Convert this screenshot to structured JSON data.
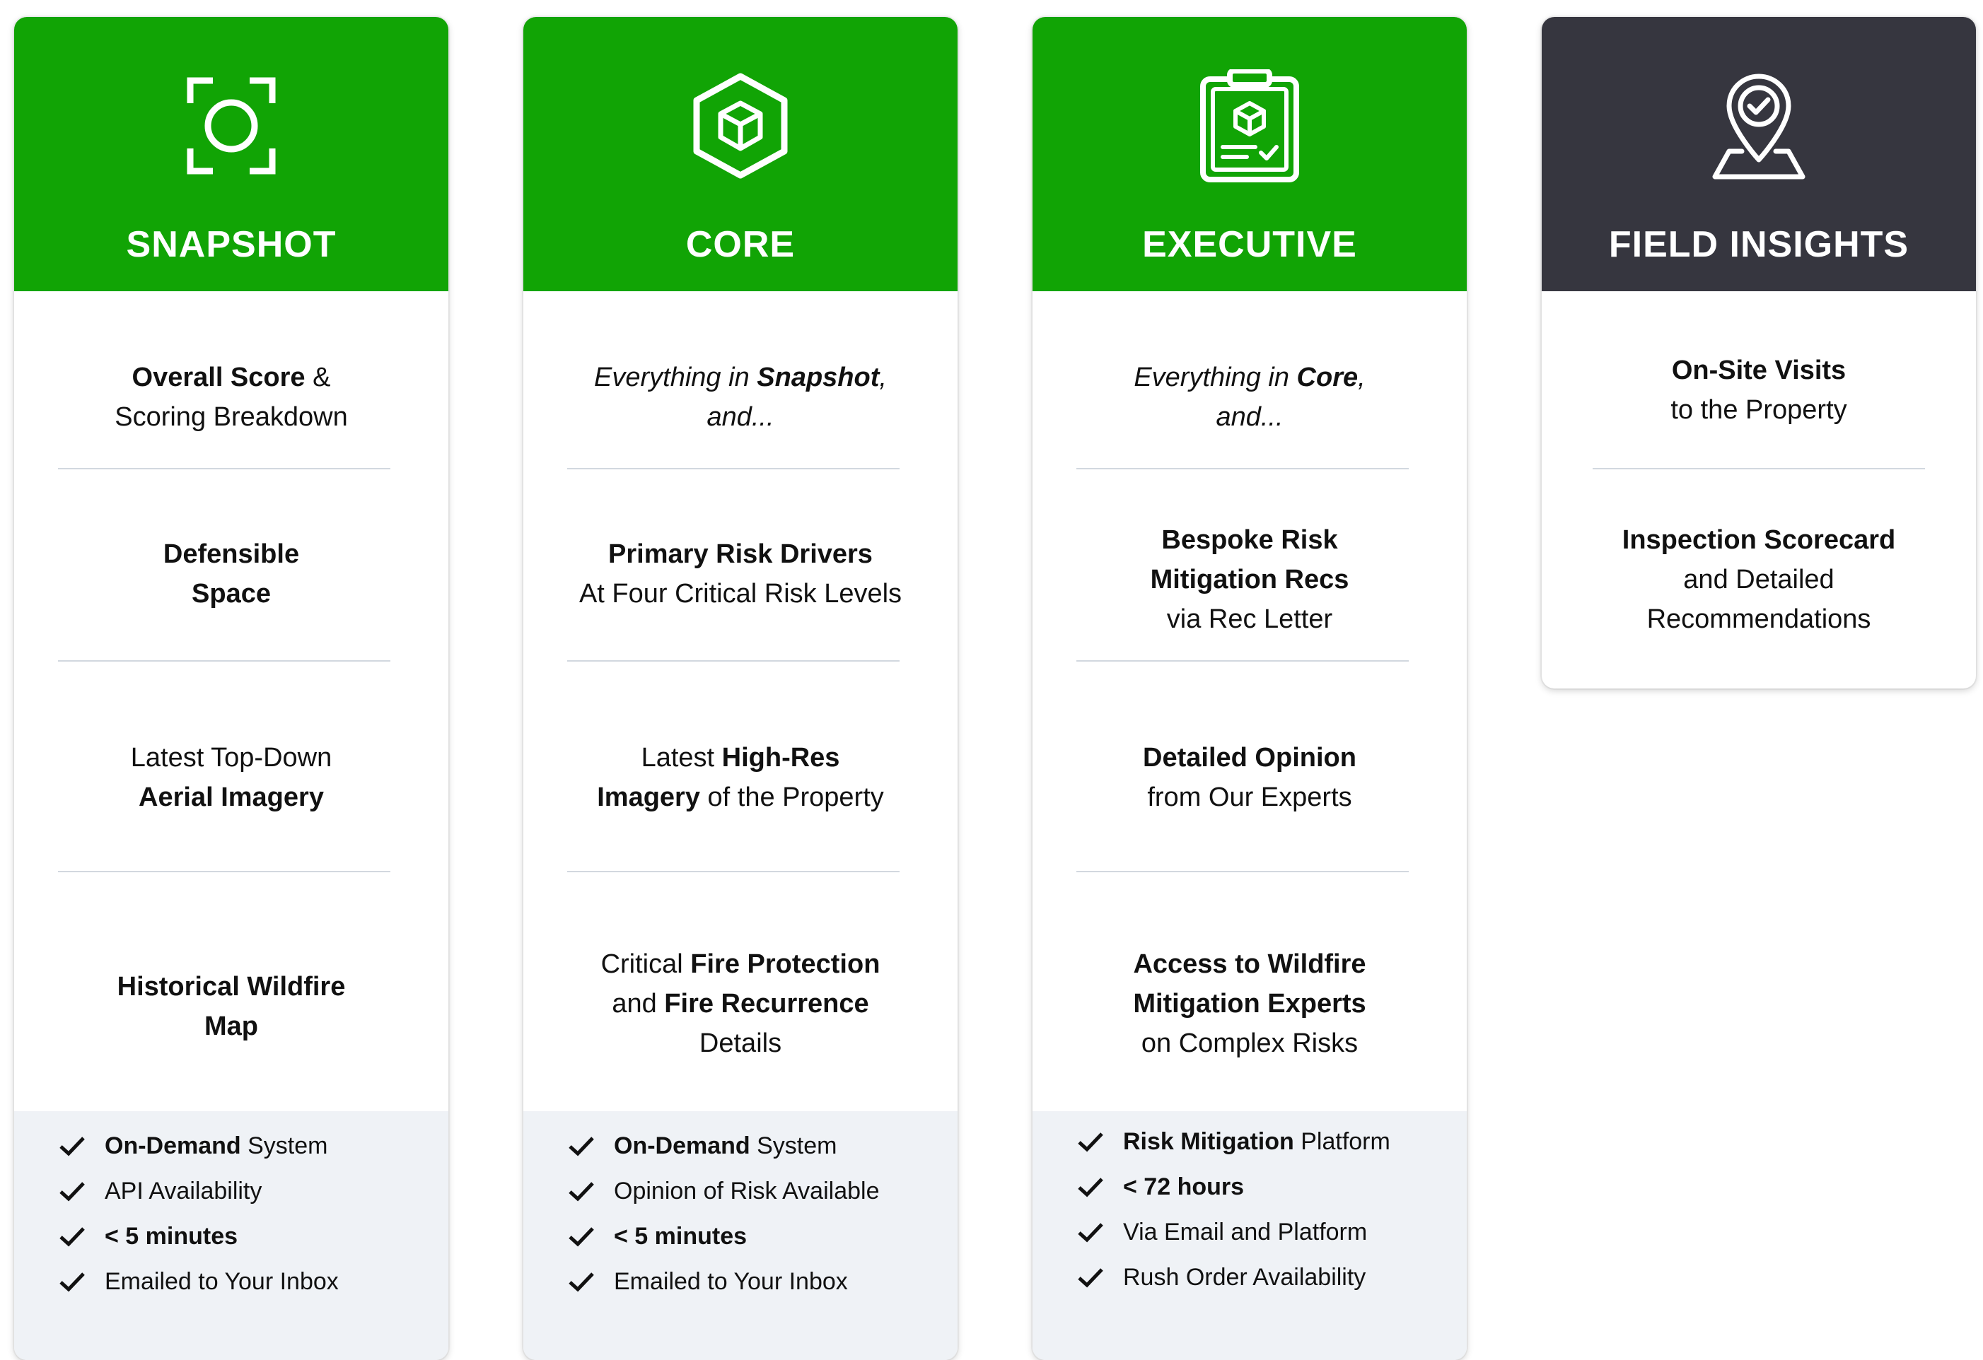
{
  "colors": {
    "accent_green": "#11a405",
    "dark_header": "#36363f",
    "footer_bg": "#eff2f6"
  },
  "cards": [
    {
      "title": "SNAPSHOT",
      "icon": "focus-frame-icon",
      "features": [
        {
          "b1": "Overall Score",
          "t1": " &",
          "t2": "Scoring Breakdown"
        },
        {
          "b1": "Defensible",
          "b2": "Space"
        },
        {
          "t1": "Latest Top-Down",
          "b2": "Aerial Imagery"
        },
        {
          "b1": "Historical Wildfire",
          "b2": "Map"
        }
      ],
      "checks": [
        {
          "b": "On-Demand",
          "t": " System"
        },
        {
          "b": "",
          "t": "API Availability"
        },
        {
          "b": "< 5 minutes",
          "t": ""
        },
        {
          "b": "",
          "t": "Emailed to Your Inbox"
        }
      ]
    },
    {
      "title": "CORE",
      "icon": "cube-hexagon-icon",
      "features": [
        {
          "i1": "Everything in ",
          "ib1": "Snapshot",
          "i2": ",",
          "i3": "and..."
        },
        {
          "b1": "Primary Risk Drivers",
          "t2": "At Four Critical Risk Levels"
        },
        {
          "t1": "Latest ",
          "b1": "High-Res",
          "b2": "Imagery",
          "t2": " of the Property"
        },
        {
          "t1": "Critical ",
          "b1": "Fire Protection",
          "t2": "and ",
          "b2": "Fire Recurrence",
          "t3": "Details"
        }
      ],
      "checks": [
        {
          "b": "On-Demand",
          "t": " System"
        },
        {
          "b": "",
          "t": "Opinion of Risk Available"
        },
        {
          "b": "< 5 minutes",
          "t": ""
        },
        {
          "b": "",
          "t": "Emailed to Your Inbox"
        }
      ]
    },
    {
      "title": "EXECUTIVE",
      "icon": "clipboard-cube-icon",
      "features": [
        {
          "i1": "Everything in ",
          "ib1": "Core",
          "i2": ",",
          "i3": "and..."
        },
        {
          "b1": "Bespoke Risk",
          "b2": "Mitigation Recs",
          "t3": "via Rec Letter"
        },
        {
          "b1": "Detailed Opinion",
          "t2": "from Our Experts"
        },
        {
          "b1": "Access to Wildfire",
          "b2": "Mitigation Experts",
          "t3": "on Complex Risks"
        }
      ],
      "checks": [
        {
          "b": "Risk Mitigation",
          "t": " Platform"
        },
        {
          "b": "< 72 hours",
          "t": ""
        },
        {
          "b": "",
          "t": "Via Email and Platform"
        },
        {
          "b": "",
          "t": "Rush Order Availability"
        }
      ]
    },
    {
      "title": "FIELD INSIGHTS",
      "icon": "location-pin-check-icon",
      "features": [
        {
          "b1": "On-Site Visits",
          "t2": "to the Property"
        },
        {
          "b1": "Inspection Scorecard",
          "t2": "and Detailed",
          "t3": "Recommendations"
        }
      ]
    }
  ]
}
